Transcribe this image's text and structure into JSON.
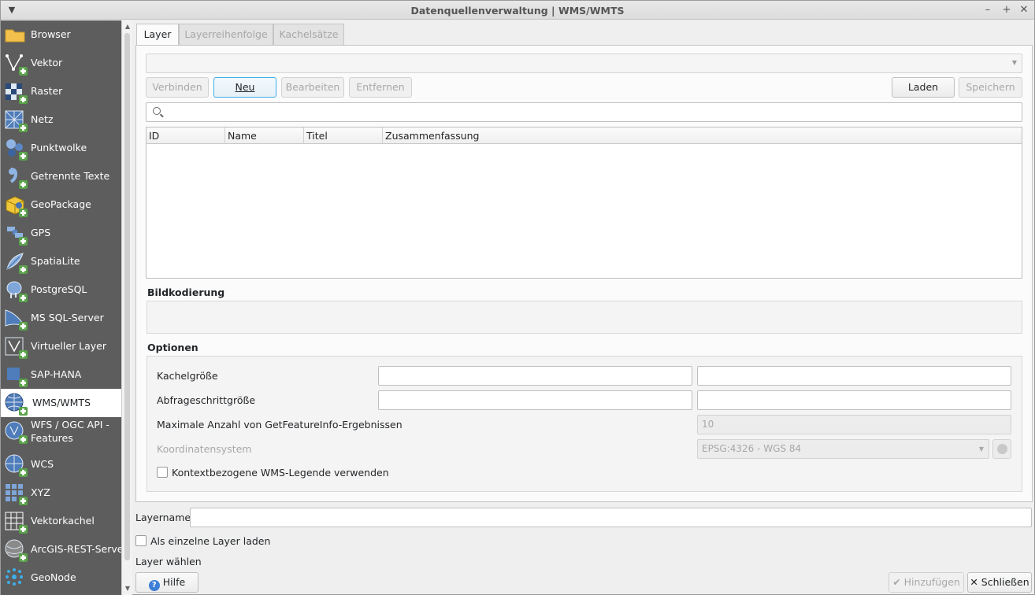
{
  "window": {
    "title": "Datenquellenverwaltung | WMS/WMTS",
    "min": "–",
    "max": "+",
    "close": "✕",
    "menu": "▼"
  },
  "sidebar": {
    "items": [
      {
        "label": "Browser",
        "icon": "folder-icon"
      },
      {
        "label": "Vektor",
        "icon": "vector-icon"
      },
      {
        "label": "Raster",
        "icon": "raster-icon"
      },
      {
        "label": "Netz",
        "icon": "mesh-icon"
      },
      {
        "label": "Punktwolke",
        "icon": "pointcloud-icon"
      },
      {
        "label": "Getrennte Texte",
        "icon": "delimited-text-icon"
      },
      {
        "label": "GeoPackage",
        "icon": "geopackage-icon"
      },
      {
        "label": "GPS",
        "icon": "gps-icon"
      },
      {
        "label": "SpatiaLite",
        "icon": "spatialite-icon"
      },
      {
        "label": "PostgreSQL",
        "icon": "postgresql-icon"
      },
      {
        "label": "MS SQL-Server",
        "icon": "mssql-icon"
      },
      {
        "label": "Virtueller Layer",
        "icon": "virtual-layer-icon"
      },
      {
        "label": "SAP-HANA",
        "icon": "sap-hana-icon"
      },
      {
        "label": "WMS/WMTS",
        "icon": "wms-icon"
      },
      {
        "label": "WFS / OGC API - Features",
        "icon": "wfs-icon"
      },
      {
        "label": "WCS",
        "icon": "wcs-icon"
      },
      {
        "label": "XYZ",
        "icon": "xyz-icon"
      },
      {
        "label": "Vektorkachel",
        "icon": "vector-tile-icon"
      },
      {
        "label": "ArcGIS-REST-Server",
        "icon": "arcgis-icon"
      },
      {
        "label": "GeoNode",
        "icon": "geonode-icon"
      }
    ]
  },
  "tabs": [
    {
      "label": "Layer"
    },
    {
      "label": "Layerreihenfolge"
    },
    {
      "label": "Kachelsätze"
    }
  ],
  "connection": {
    "selected": "",
    "buttons": {
      "connect": "Verbinden",
      "new": "Neu",
      "edit": "Bearbeiten",
      "remove": "Entfernen",
      "load": "Laden",
      "save": "Speichern"
    }
  },
  "search": {
    "placeholder": ""
  },
  "table": {
    "columns": [
      "ID",
      "Name",
      "Titel",
      "Zusammenfassung"
    ],
    "rows": []
  },
  "encoding": {
    "title": "Bildkodierung"
  },
  "options": {
    "title": "Optionen",
    "tile_size_label": "Kachelgröße",
    "step_size_label": "Abfrageschrittgröße",
    "max_feature_label": "Maximale Anzahl von GetFeatureInfo-Ergebnissen",
    "max_feature_value": "10",
    "crs_label": "Koordinatensystem",
    "crs_value": "EPSG:4326 - WGS 84",
    "legend_label": "Kontextbezogene WMS-Legende verwenden"
  },
  "bottom": {
    "layername_label": "Layername",
    "single_layer_label": "Als einzelne Layer laden",
    "status": "Layer wählen",
    "help": "Hilfe",
    "add": "Hinzufügen",
    "close": "Schließen"
  },
  "colors": {
    "sidebar_bg": "#5d5d5d",
    "accent": "#3daee9",
    "plus_green": "#5aa24a"
  }
}
